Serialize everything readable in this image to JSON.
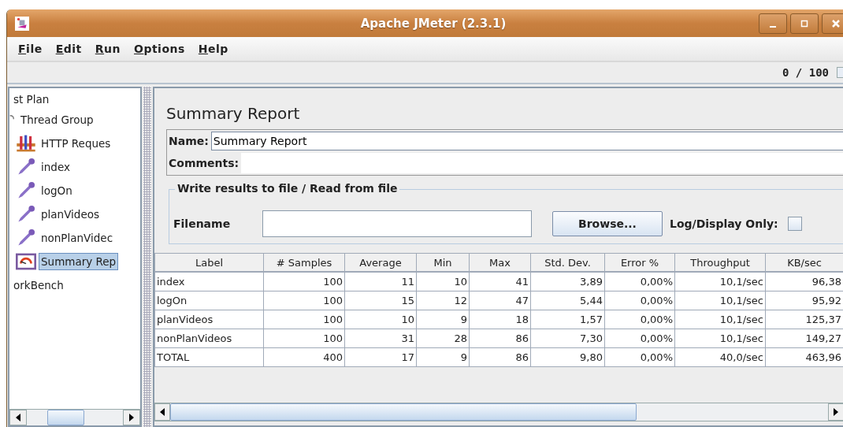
{
  "window": {
    "title": "Apache JMeter (2.3.1)"
  },
  "menu": [
    "File",
    "Edit",
    "Run",
    "Options",
    "Help"
  ],
  "toolbar": {
    "counter": "0 / 100"
  },
  "tree": [
    {
      "label": "st Plan",
      "selected": false,
      "children": [
        {
          "label": "Thread Group",
          "kind": "thread",
          "selected": false,
          "children": [
            {
              "label": "HTTP Reques",
              "kind": "defaults",
              "selected": false
            },
            {
              "label": "index",
              "kind": "sampler",
              "selected": false
            },
            {
              "label": "logOn",
              "kind": "sampler",
              "selected": false
            },
            {
              "label": "planVideos",
              "kind": "sampler",
              "selected": false
            },
            {
              "label": "nonPlanVidec",
              "kind": "sampler",
              "selected": false
            },
            {
              "label": "Summary Rep",
              "kind": "report",
              "selected": true
            }
          ]
        }
      ]
    },
    {
      "label": "orkBench",
      "selected": false
    }
  ],
  "panel": {
    "title": "Summary Report",
    "name_label": "Name:",
    "name_value": "Summary Report",
    "comments_label": "Comments:",
    "file_group": {
      "title": "Write results to file / Read from file",
      "filename_label": "Filename",
      "browse_button": "Browse...",
      "log_only_label": "Log/Display Only:",
      "log_only_checked": false
    }
  },
  "table": {
    "columns": [
      "Label",
      "# Samples",
      "Average",
      "Min",
      "Max",
      "Std. Dev.",
      "Error %",
      "Throughput",
      "KB/sec"
    ],
    "rows": [
      [
        "index",
        "100",
        "11",
        "10",
        "41",
        "3,89",
        "0,00%",
        "10,1/sec",
        "96,38"
      ],
      [
        "logOn",
        "100",
        "15",
        "12",
        "47",
        "5,44",
        "0,00%",
        "10,1/sec",
        "95,92"
      ],
      [
        "planVideos",
        "100",
        "10",
        "9",
        "18",
        "1,57",
        "0,00%",
        "10,1/sec",
        "125,37"
      ],
      [
        "nonPlanVideos",
        "100",
        "31",
        "28",
        "86",
        "7,30",
        "0,00%",
        "10,1/sec",
        "149,27"
      ],
      [
        "TOTAL",
        "400",
        "17",
        "9",
        "86",
        "9,80",
        "0,00%",
        "40,0/sec",
        "463,96"
      ]
    ]
  }
}
